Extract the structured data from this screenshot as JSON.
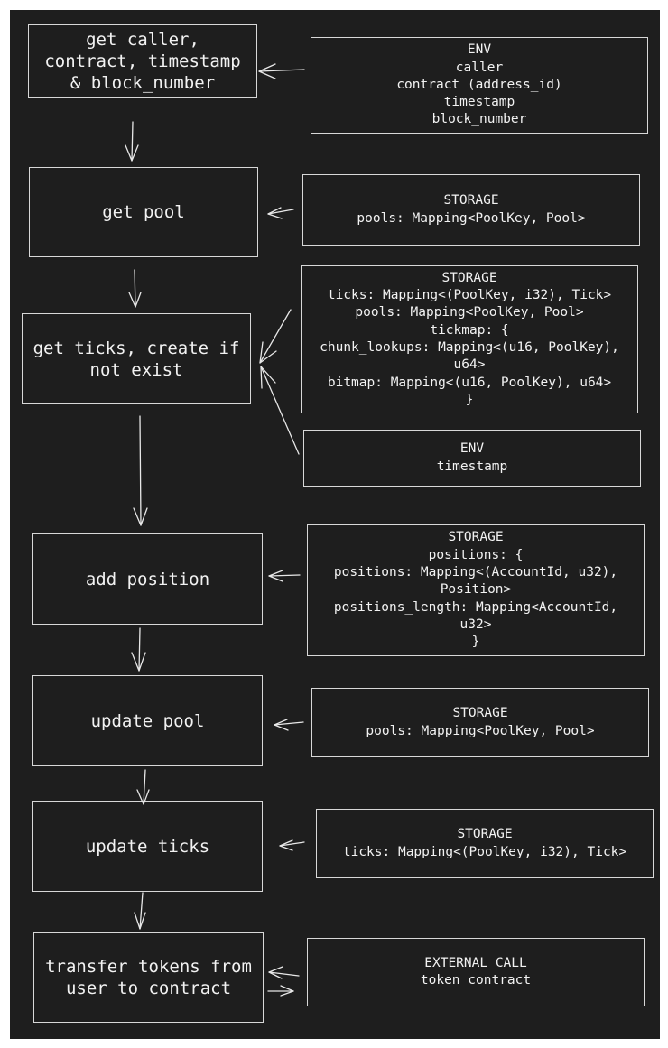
{
  "diagram": {
    "steps": [
      {
        "id": "get-context",
        "lines": [
          "get caller,",
          "contract, timestamp",
          "& block_number"
        ]
      },
      {
        "id": "get-pool",
        "lines": [
          "get pool"
        ]
      },
      {
        "id": "get-ticks",
        "lines": [
          "get ticks, create if",
          "not exist"
        ]
      },
      {
        "id": "add-position",
        "lines": [
          "add position"
        ]
      },
      {
        "id": "update-pool",
        "lines": [
          "update pool"
        ]
      },
      {
        "id": "update-ticks",
        "lines": [
          "update ticks"
        ]
      },
      {
        "id": "transfer-tokens",
        "lines": [
          "transfer tokens from",
          "user to contract"
        ]
      }
    ],
    "sources": [
      {
        "id": "env-context",
        "target": "get-context",
        "lines": [
          "ENV",
          "caller",
          "contract (address_id)",
          "timestamp",
          "block_number"
        ]
      },
      {
        "id": "storage-pools-1",
        "target": "get-pool",
        "lines": [
          "STORAGE",
          "pools: Mapping<PoolKey, Pool>"
        ]
      },
      {
        "id": "storage-ticks-tickmap",
        "target": "get-ticks",
        "lines": [
          "STORAGE",
          "ticks: Mapping<(PoolKey, i32), Tick>",
          "pools: Mapping<PoolKey, Pool>",
          "tickmap: {",
          "chunk_lookups: Mapping<(u16, PoolKey),",
          "u64>",
          "bitmap: Mapping<(u16, PoolKey), u64>",
          "}"
        ]
      },
      {
        "id": "env-timestamp",
        "target": "get-ticks",
        "lines": [
          "ENV",
          "timestamp"
        ]
      },
      {
        "id": "storage-positions",
        "target": "add-position",
        "lines": [
          "STORAGE",
          "positions: {",
          "positions: Mapping<(AccountId, u32),",
          "Position>",
          "positions_length: Mapping<AccountId,",
          "u32>",
          "}"
        ]
      },
      {
        "id": "storage-pools-2",
        "target": "update-pool",
        "lines": [
          "STORAGE",
          "pools: Mapping<PoolKey, Pool>"
        ]
      },
      {
        "id": "storage-ticks",
        "target": "update-ticks",
        "lines": [
          "STORAGE",
          "ticks: Mapping<(PoolKey, i32), Tick>"
        ]
      },
      {
        "id": "external-call",
        "target": "transfer-tokens",
        "lines": [
          "EXTERNAL CALL",
          "token contract"
        ]
      }
    ],
    "colors": {
      "background": "#1e1e1e",
      "stroke": "#d8d8d8",
      "text": "#f2f2f2",
      "page": "#ffffff"
    }
  }
}
